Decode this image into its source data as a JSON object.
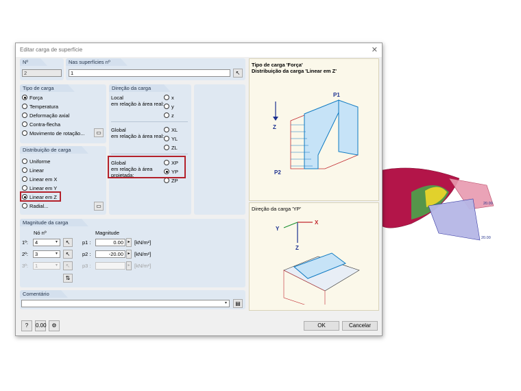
{
  "dialog": {
    "title": "Editar carga de superfície"
  },
  "no": {
    "label": "Nº",
    "value": "2"
  },
  "surfaces": {
    "label": "Nas superfícies nº",
    "value": "1"
  },
  "load_type": {
    "title": "Tipo de carga",
    "options": [
      "Força",
      "Temperatura",
      "Deformação axial",
      "Contra-flecha",
      "Movimento de rotação..."
    ],
    "selected": "Força"
  },
  "load_direction": {
    "title": "Direção da carga",
    "local_label": "Local\nem relação à área real:",
    "local_options": [
      "x",
      "y",
      "z"
    ],
    "global_label": "Global\nem relação à área real:",
    "global_options": [
      "XL",
      "YL",
      "ZL"
    ],
    "projected_label": "Global\nem relação à área\nprojetada:",
    "projected_options": [
      "XP",
      "YP",
      "ZP"
    ],
    "selected": "YP"
  },
  "load_distribution": {
    "title": "Distribuição de carga",
    "options": [
      "Uniforme",
      "Linear",
      "Linear em X",
      "Linear em Y",
      "Linear em Z",
      "Radial..."
    ],
    "selected": "Linear em Z"
  },
  "magnitude": {
    "title": "Magnitude da carga",
    "node_header": "Nó nº",
    "mag_header": "Magnitude",
    "rows": [
      {
        "index": "1º:",
        "node": "4",
        "p_label": "p1 :",
        "value": "0.00",
        "unit": "[kN/m²]",
        "enabled": true
      },
      {
        "index": "2º:",
        "node": "3",
        "p_label": "p2 :",
        "value": "-20.00",
        "unit": "[kN/m²]",
        "enabled": true
      },
      {
        "index": "3º:",
        "node": "1",
        "p_label": "p3 :",
        "value": "",
        "unit": "[kN/m²]",
        "enabled": false
      }
    ]
  },
  "comment": {
    "title": "Comentário",
    "value": ""
  },
  "buttons": {
    "ok": "OK",
    "cancel": "Cancelar"
  },
  "info_panel": {
    "line1": "Tipo de carga 'Força'",
    "line2": "Distribuição da carga 'Linear em Z'",
    "p1": "P1",
    "p2": "P2",
    "z": "Z"
  },
  "direction_panel": {
    "title": "Direção da carga 'YP'",
    "x": "X",
    "y": "Y",
    "z": "Z"
  },
  "background_model": {
    "label_a": "20.00",
    "label_b": "20.00"
  },
  "colors": {
    "accent_red": "#b3202a",
    "group_bg": "#dfe8f2",
    "panel_bg": "#fbf8ea"
  }
}
